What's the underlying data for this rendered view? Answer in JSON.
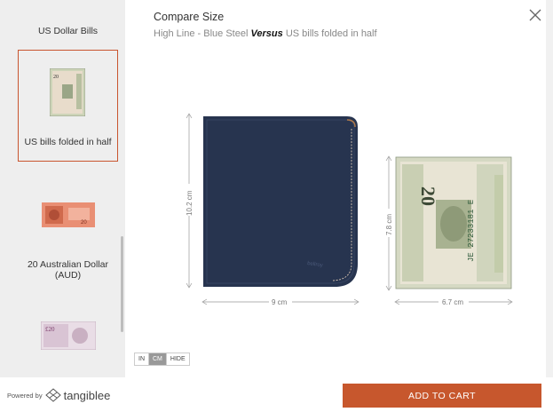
{
  "sidebar": {
    "items": [
      {
        "label": "US Dollar Bills"
      },
      {
        "label": "US bills folded in half",
        "selected": true
      },
      {
        "label": "20 Australian Dollar (AUD)"
      },
      {
        "label": ""
      }
    ]
  },
  "header": {
    "title": "Compare Size",
    "subtitle_prefix": "High Line - Blue Steel",
    "subtitle_versus": "Versus",
    "subtitle_suffix": "US bills folded in half"
  },
  "comparison": {
    "wallet_height": "10.2 cm",
    "wallet_width": "9 cm",
    "bill_height": "7.8 cm",
    "bill_width": "6.7 cm",
    "wallet_brand": "bellroy",
    "bill_serial": "JE 27233181 E",
    "bill_denom": "20"
  },
  "units": {
    "options": [
      "IN",
      "CM",
      "HIDE"
    ],
    "active": "CM"
  },
  "footer": {
    "powered_by": "Powered by",
    "brand": "tangiblee",
    "cart_label": "ADD TO CART"
  },
  "colors": {
    "accent": "#c7572d",
    "wallet": "#27344f",
    "sidebar_bg": "#eeeeee"
  }
}
